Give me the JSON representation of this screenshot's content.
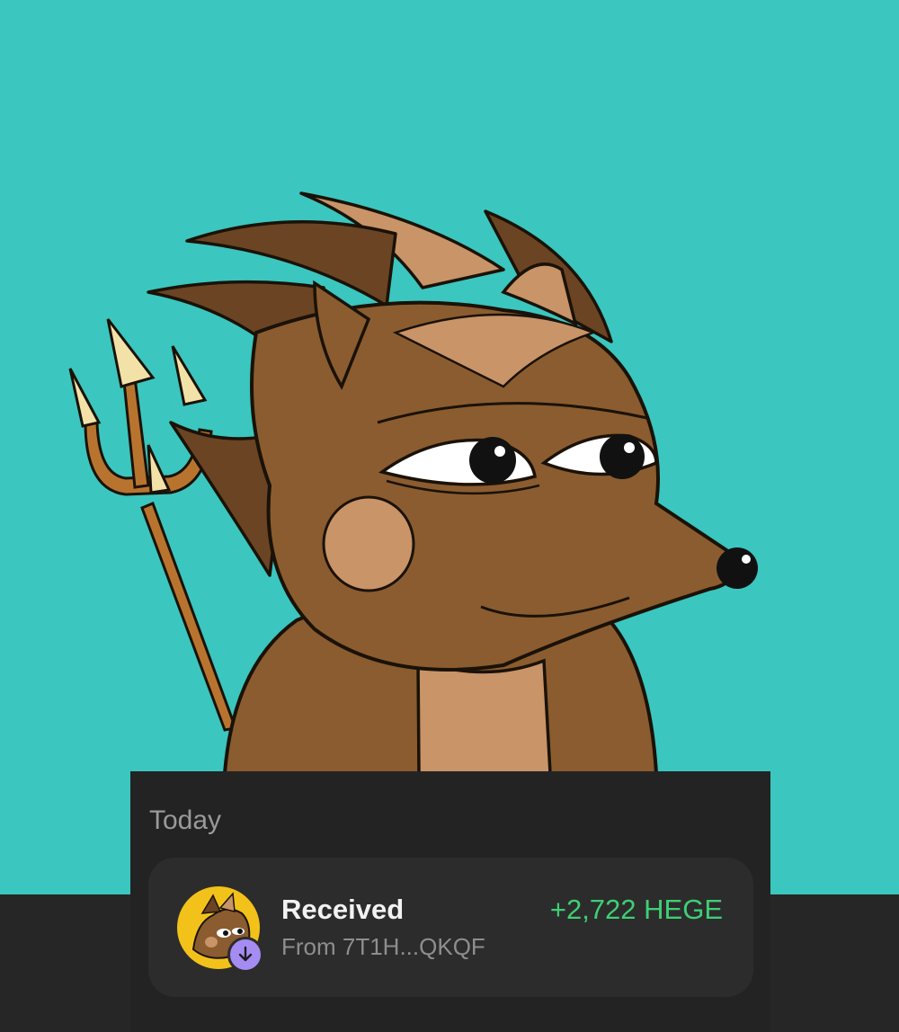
{
  "colors": {
    "art_background": "#3bc6bf",
    "panel_background": "#232323",
    "card_background": "#2c2c2c",
    "positive_amount": "#3ecf74",
    "badge": "#a58cf3"
  },
  "artwork": {
    "subject": "cartoon brown hedgehog character holding a trident",
    "icon": "hedgehog-illustration"
  },
  "activity": {
    "section_label": "Today",
    "transaction": {
      "title": "Received",
      "subtitle": "From 7T1H...QKQF",
      "amount": "+2,722 HEGE",
      "avatar_icon": "token-avatar",
      "badge_icon": "arrow-down-icon"
    }
  }
}
